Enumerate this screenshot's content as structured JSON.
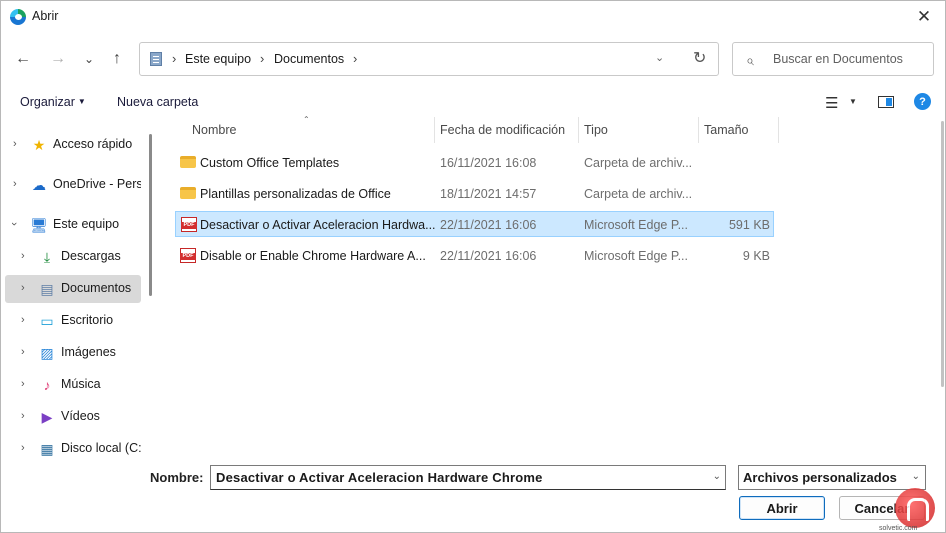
{
  "window": {
    "title": "Abrir",
    "close_glyph": "✕"
  },
  "nav": {
    "back_glyph": "←",
    "forward_glyph": "→",
    "recent_glyph": "⌄",
    "up_glyph": "↑",
    "breadcrumbs": [
      "Este equipo",
      "Documentos"
    ],
    "separator": "›",
    "dropdown_glyph": "⌄",
    "refresh_glyph": "↻",
    "search_placeholder": "Buscar en Documentos"
  },
  "toolbar": {
    "organize_label": "Organizar",
    "new_folder_label": "Nueva carpeta",
    "caret": "▼",
    "view_glyph": "☰",
    "help_glyph": "?"
  },
  "sidebar": {
    "items": [
      {
        "label": "Acceso rápido",
        "icon": "star-icon",
        "glyph": "★",
        "color": "#f0b400"
      },
      {
        "label": "OneDrive - Pers",
        "icon": "cloud-icon",
        "glyph": "☁",
        "color": "#1b6ac9"
      },
      {
        "label": "Este equipo",
        "icon": "computer-icon",
        "glyph": "🖥",
        "color": "#2a7bd4"
      },
      {
        "label": "Descargas",
        "icon": "download-icon",
        "glyph": "⤓",
        "color": "#1b8a3a"
      },
      {
        "label": "Documentos",
        "icon": "documents-icon",
        "glyph": "▤",
        "color": "#5f7fa6"
      },
      {
        "label": "Escritorio",
        "icon": "desktop-icon",
        "glyph": "▭",
        "color": "#1ea0d8"
      },
      {
        "label": "Imágenes",
        "icon": "pictures-icon",
        "glyph": "▨",
        "color": "#2a86d8"
      },
      {
        "label": "Música",
        "icon": "music-icon",
        "glyph": "♪",
        "color": "#e0457b"
      },
      {
        "label": "Vídeos",
        "icon": "videos-icon",
        "glyph": "▶",
        "color": "#7b3fc4"
      },
      {
        "label": "Disco local (C:",
        "icon": "drive-icon",
        "glyph": "▦",
        "color": "#2f6f9e"
      }
    ]
  },
  "file_list": {
    "columns": [
      "Nombre",
      "Fecha de modificación",
      "Tipo",
      "Tamaño"
    ],
    "sort_glyph": "⌃",
    "rows": [
      {
        "name": "Custom Office Templates",
        "date": "16/11/2021 16:08",
        "type": "Carpeta de archiv...",
        "size": "",
        "kind": "folder"
      },
      {
        "name": "Plantillas personalizadas de Office",
        "date": "18/11/2021 14:57",
        "type": "Carpeta de archiv...",
        "size": "",
        "kind": "folder"
      },
      {
        "name": "Desactivar o Activar Aceleracion Hardwa...",
        "date": "22/11/2021 16:06",
        "type": "Microsoft Edge P...",
        "size": "591 KB",
        "kind": "pdf"
      },
      {
        "name": "Disable or Enable Chrome Hardware A...",
        "date": "22/11/2021 16:06",
        "type": "Microsoft Edge P...",
        "size": "9 KB",
        "kind": "pdf"
      }
    ]
  },
  "footer": {
    "name_label": "Nombre:",
    "name_value": "Desactivar o Activar Aceleracion Hardware Chrome",
    "dropdown_glyph": "⌄",
    "filter_value": "Archivos personalizados",
    "open_label": "Abrir",
    "cancel_label": "Cancelar"
  },
  "watermark": {
    "text": "solvetic.com"
  },
  "colors": {
    "selection_bg": "#cce8ff",
    "selection_border": "#99d1ff",
    "sidebar_selected": "#d9d9d9",
    "accent": "#0f6cbd"
  }
}
